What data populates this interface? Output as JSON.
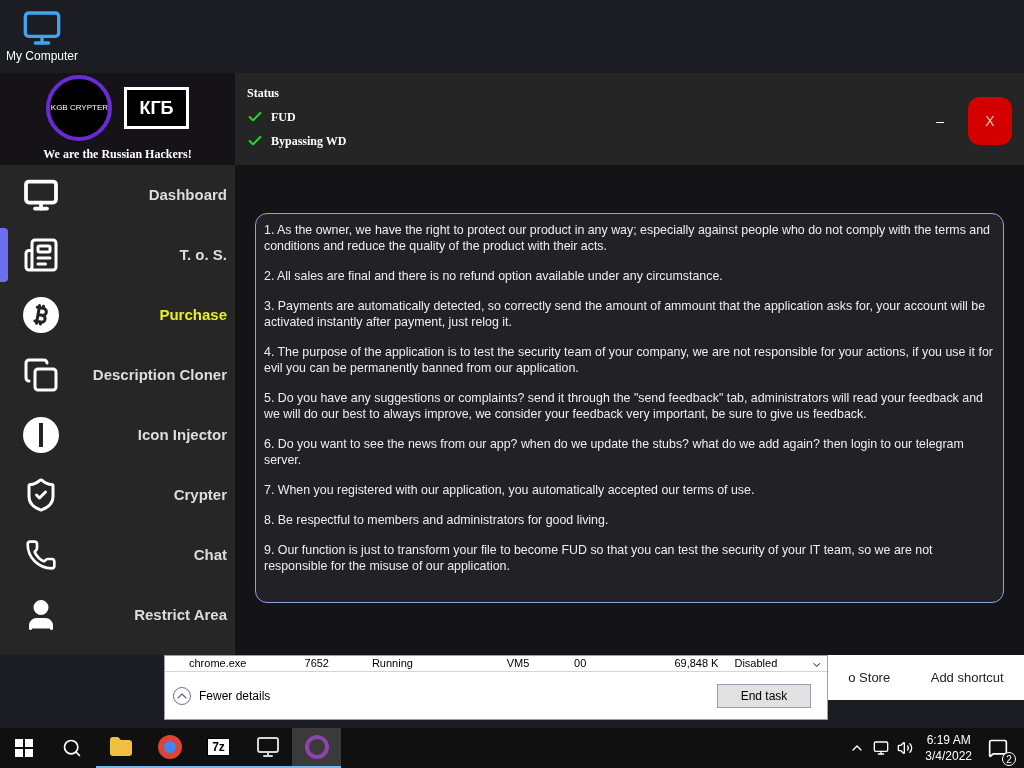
{
  "desktop": {
    "icon_label": "My Computer"
  },
  "background_windows": {
    "task_manager": {
      "row": [
        "chrome.exe",
        "7652",
        "Running",
        "VM5",
        "00",
        "69,848 K",
        "Disabled"
      ],
      "fewer_details": "Fewer details",
      "end_task": "End task"
    },
    "other_window": {
      "texts": [
        "o Store",
        "Add shortcut"
      ]
    }
  },
  "app": {
    "slogan": "We are the Russian Hackers!",
    "logo_badge": "KGB CRYPTER",
    "logo_text": "КГБ",
    "status": {
      "title": "Status",
      "items": [
        {
          "label": "FUD",
          "ok": true
        },
        {
          "label": "Bypassing WD",
          "ok": true
        }
      ]
    },
    "window_buttons": {
      "minimize": "–",
      "close": "X"
    },
    "sidebar": [
      {
        "kind": "monitor",
        "label": "Dashboard",
        "selected": false,
        "highlighted": false
      },
      {
        "kind": "newspaper",
        "label": "T. o. S.",
        "selected": true,
        "highlighted": false
      },
      {
        "kind": "bitcoin",
        "label": "Purchase",
        "selected": false,
        "highlighted": true
      },
      {
        "kind": "copy",
        "label": "Description Cloner",
        "selected": false,
        "highlighted": false
      },
      {
        "kind": "info",
        "label": "Icon Injector",
        "selected": false,
        "highlighted": false
      },
      {
        "kind": "shield",
        "label": "Crypter",
        "selected": false,
        "highlighted": false
      },
      {
        "kind": "phone",
        "label": "Chat",
        "selected": false,
        "highlighted": false
      },
      {
        "kind": "person",
        "label": "Restrict Area",
        "selected": false,
        "highlighted": false
      }
    ],
    "terms": [
      "1. As the owner, we have the right to protect our product in any way; especially against people who do not comply with the terms and conditions and reduce the quality of the product with their acts.",
      "2. All sales are final and there is no refund option available under any circumstance.",
      "3. Payments are automatically detected, so correctly send the amount of ammount that the application asks for, your account will be activated instantly after payment, just relog it.",
      "4. The purpose of the application is to test the security team of your company, we are not responsible for your actions, if you use it for evil you can be permanently banned from our application.",
      "5. Do you have any suggestions or complaints? send it through the \"send feedback\" tab, administrators will read your feedback and we will do our best to always improve, we consider your feedback very important, be sure to give us feedback.",
      "6. Do you want to see the news from our app? when do we update the stubs? what do we add again? then login to our telegram server.",
      "7. When you registered with our application, you automatically accepted our terms of use.",
      "8. Be respectful to members and administrators for good living.",
      "9. Our function is just to transform your file to become FUD so that you can test the security of your IT team, so we are not responsible for the misuse of our application."
    ]
  },
  "taskbar": {
    "apps": [
      {
        "kind": "folder",
        "active": false
      },
      {
        "kind": "chrome",
        "active": false
      },
      {
        "kind": "archiver",
        "label": "7z",
        "active": false
      },
      {
        "kind": "monitor",
        "active": false
      },
      {
        "kind": "app",
        "active": true
      }
    ],
    "time": "6:19 AM",
    "date": "3/4/2022",
    "notifications": "2"
  }
}
